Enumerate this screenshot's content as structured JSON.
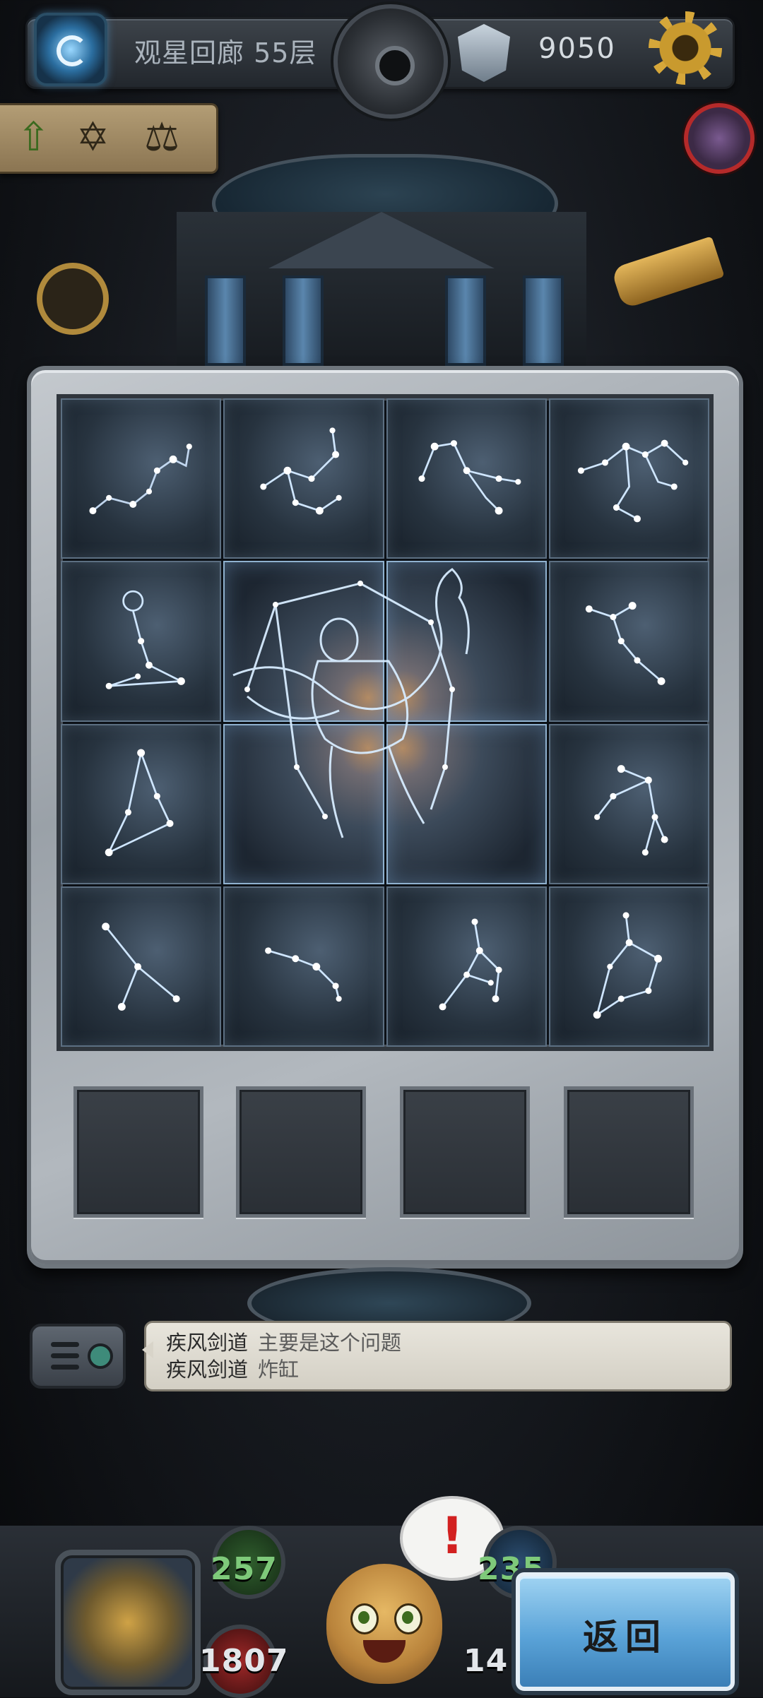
{
  "top_bar": {
    "floor_title": "观星回廊 55层",
    "currency_value": "9050",
    "icons": [
      "portal-icon",
      "camera-disc-icon",
      "gem-icon",
      "gear-icon"
    ]
  },
  "rune_panel": {
    "runes": [
      {
        "name": "up-arrow-rune",
        "glyph": "⇧"
      },
      {
        "name": "hexagram-rune",
        "glyph": "✡"
      },
      {
        "name": "scales-rune",
        "glyph": "⚖"
      }
    ]
  },
  "puzzle": {
    "rows": 4,
    "cols": 4,
    "center_image": "serpent-bearer-constellation",
    "empty_slots": 4
  },
  "chat": {
    "messages": [
      {
        "user": "疾风剑道",
        "text": "主要是这个问题"
      },
      {
        "user": "疾风剑道",
        "text": "炸缸"
      }
    ]
  },
  "hud": {
    "stats": [
      {
        "value": "257",
        "color": "#7ec97a"
      },
      {
        "value": "1807",
        "color": "#e3e6ea"
      },
      {
        "value": "235",
        "color": "#7ec97a"
      },
      {
        "value": "14",
        "color": "#e3e6ea"
      }
    ],
    "alert_mark": "!",
    "back_label": "返回"
  }
}
